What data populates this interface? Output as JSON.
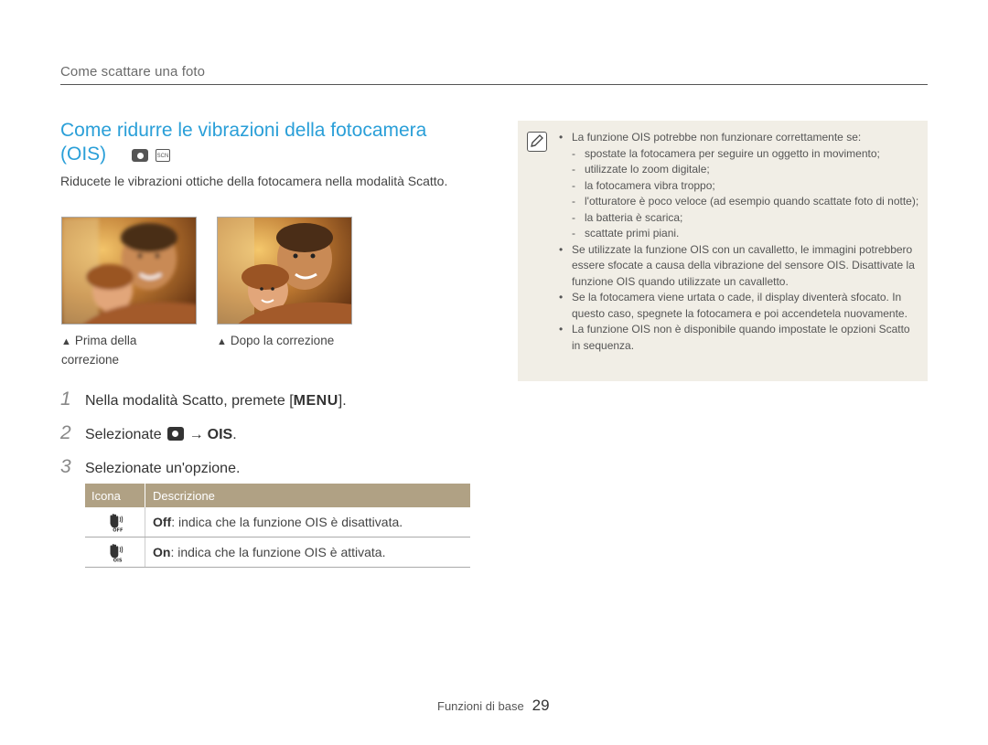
{
  "header": {
    "section_title": "Come scattare una foto"
  },
  "main": {
    "title": "Come ridurre le vibrazioni della fotocamera (OIS)",
    "mode_icons": [
      "camera-program-icon",
      "scene-mode-icon"
    ],
    "intro": "Riducete le vibrazioni ottiche della fotocamera nella modalità Scatto.",
    "photos": [
      {
        "caption_marker": "▲",
        "caption": "Prima della correzione"
      },
      {
        "caption_marker": "▲",
        "caption": "Dopo la correzione"
      }
    ],
    "steps": [
      {
        "num": "1",
        "text_before": "Nella modalità Scatto, premete [",
        "key": "MENU",
        "text_after": "]."
      },
      {
        "num": "2",
        "text_before": "Selezionate",
        "arrow": "→",
        "option": "OIS",
        "text_after": "."
      },
      {
        "num": "3",
        "text": "Selezionate un'opzione."
      }
    ],
    "table": {
      "headers": [
        "Icona",
        "Descrizione"
      ],
      "rows": [
        {
          "icon": "ois-off-hand-icon",
          "term": "Off",
          "desc": ": indica che la funzione OIS è disattivata."
        },
        {
          "icon": "ois-on-hand-icon",
          "term": "On",
          "desc": ": indica che la funzione OIS è attivata."
        }
      ]
    }
  },
  "note": {
    "icon": "note-pencil-icon",
    "bullet1": "La funzione OIS potrebbe non funzionare correttamente se:",
    "subitems": [
      "spostate la fotocamera per seguire un oggetto in movimento;",
      "utilizzate lo zoom digitale;",
      "la fotocamera vibra troppo;",
      "l'otturatore è poco veloce (ad esempio quando scattate foto di notte);",
      "la batteria è scarica;",
      "scattate primi piani."
    ],
    "bullet2": "Se utilizzate la funzione OIS con un cavalletto, le immagini potrebbero essere sfocate a causa della vibrazione del sensore OIS. Disattivate la funzione OIS quando utilizzate un cavalletto.",
    "bullet3": "Se la fotocamera viene urtata o cade, il display diventerà sfocato. In questo caso, spegnete la fotocamera e poi accendetela nuovamente.",
    "bullet4": "La funzione OIS non è disponibile quando impostate le opzioni Scatto in sequenza."
  },
  "footer": {
    "label": "Funzioni di base",
    "page": "29"
  }
}
